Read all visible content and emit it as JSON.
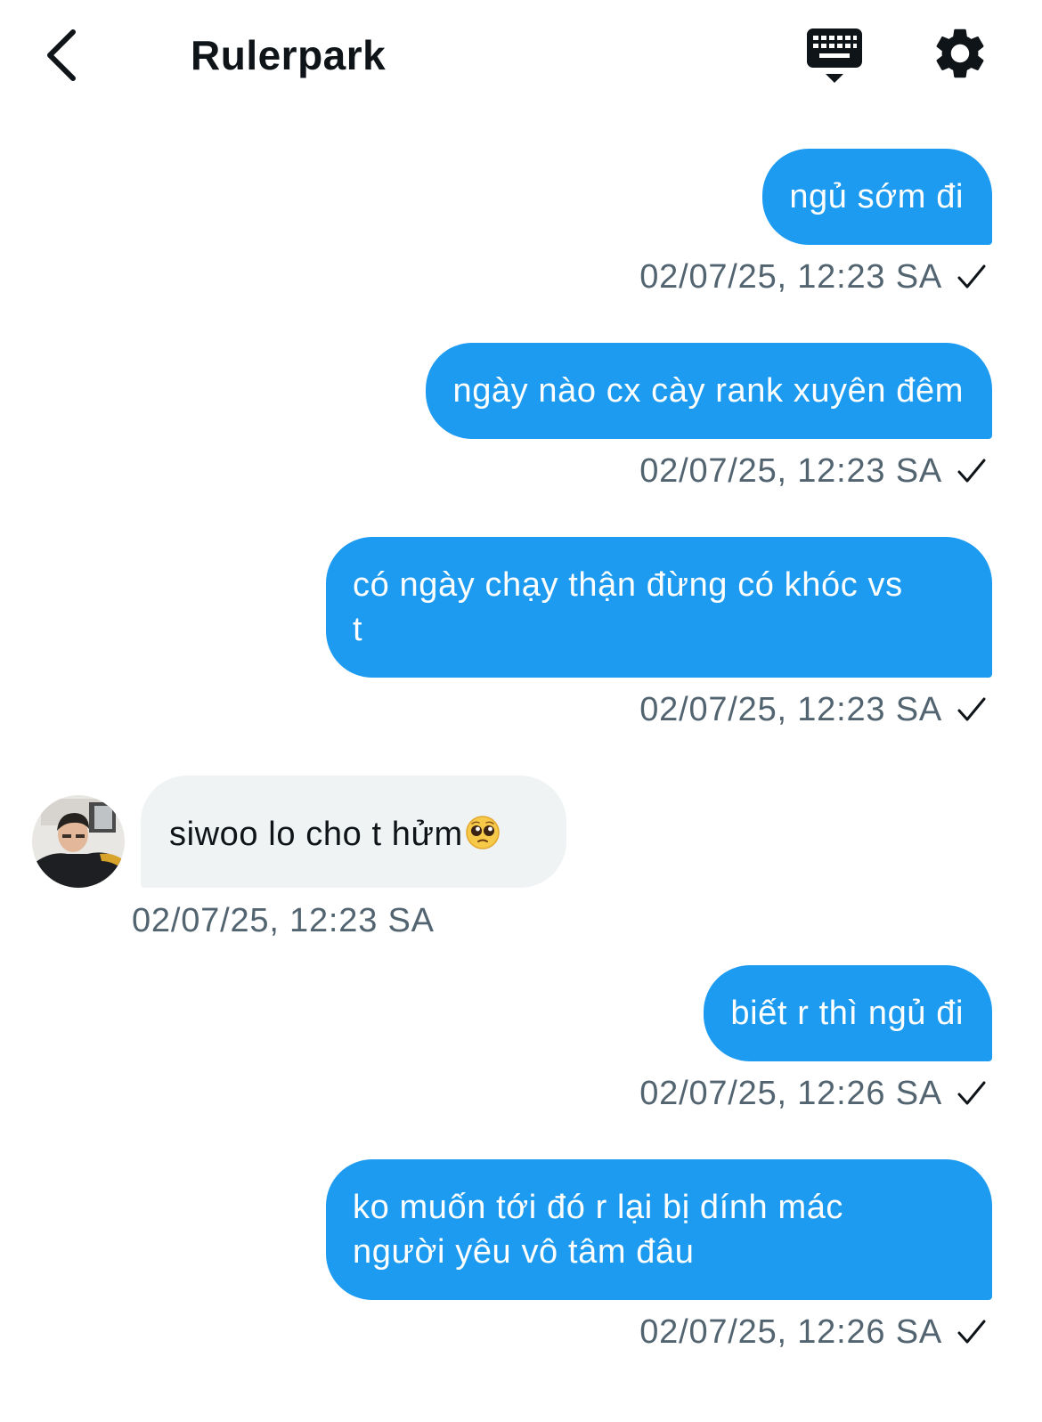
{
  "header": {
    "title": "Rulerpark"
  },
  "messages": [
    {
      "direction": "out",
      "text": "ngủ sớm đi",
      "timestamp": "02/07/25, 12:23 SA",
      "status": "sent"
    },
    {
      "direction": "out",
      "text": "ngày nào cx cày rank xuyên đêm",
      "timestamp": "02/07/25, 12:23 SA",
      "status": "sent"
    },
    {
      "direction": "out",
      "text_line1": "có ngày chạy thận đừng có khóc vs",
      "text_line2": "t",
      "timestamp": "02/07/25, 12:23 SA",
      "status": "sent"
    },
    {
      "direction": "in",
      "text": "siwoo lo cho t hửm",
      "emoji": "pleading-face",
      "timestamp": "02/07/25, 12:23 SA"
    },
    {
      "direction": "out",
      "text": "biết r thì ngủ đi",
      "timestamp": "02/07/25, 12:26 SA",
      "status": "sent"
    },
    {
      "direction": "out",
      "text_line1": "ko muốn tới đó r lại bị dính mác",
      "text_line2": "người yêu vô tâm đâu",
      "timestamp": "02/07/25, 12:26 SA",
      "status": "sent"
    }
  ],
  "colors": {
    "outgoing_bubble": "#1d9bf0",
    "incoming_bubble": "#eff3f4",
    "timestamp": "#536471"
  }
}
